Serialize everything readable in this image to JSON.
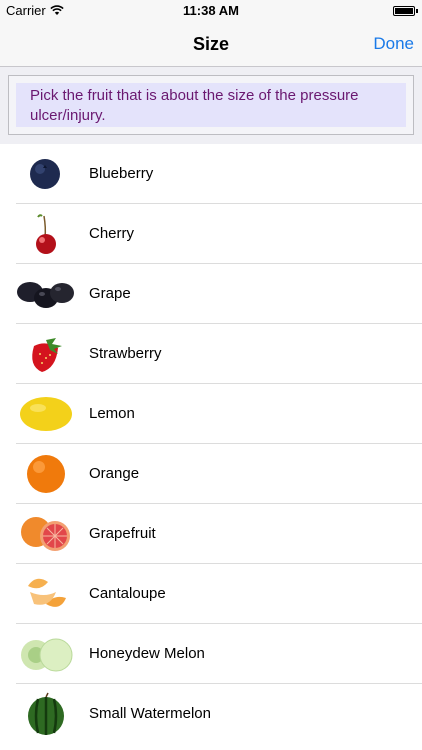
{
  "status_bar": {
    "carrier": "Carrier",
    "time": "11:38 AM"
  },
  "nav": {
    "title": "Size",
    "done_label": "Done"
  },
  "instruction": "Pick the fruit that is about the size of the pressure ulcer/injury.",
  "fruits": [
    {
      "label": "Blueberry",
      "icon": "blueberry-icon"
    },
    {
      "label": "Cherry",
      "icon": "cherry-icon"
    },
    {
      "label": "Grape",
      "icon": "grape-icon"
    },
    {
      "label": "Strawberry",
      "icon": "strawberry-icon"
    },
    {
      "label": "Lemon",
      "icon": "lemon-icon"
    },
    {
      "label": "Orange",
      "icon": "orange-icon"
    },
    {
      "label": "Grapefruit",
      "icon": "grapefruit-icon"
    },
    {
      "label": "Cantaloupe",
      "icon": "cantaloupe-icon"
    },
    {
      "label": "Honeydew Melon",
      "icon": "honeydew-melon-icon"
    },
    {
      "label": "Small Watermelon",
      "icon": "watermelon-icon"
    }
  ],
  "colors": {
    "accent": "#1a7ae8",
    "instruction_text": "#6a1870",
    "instruction_bg": "#e4e3fb"
  }
}
